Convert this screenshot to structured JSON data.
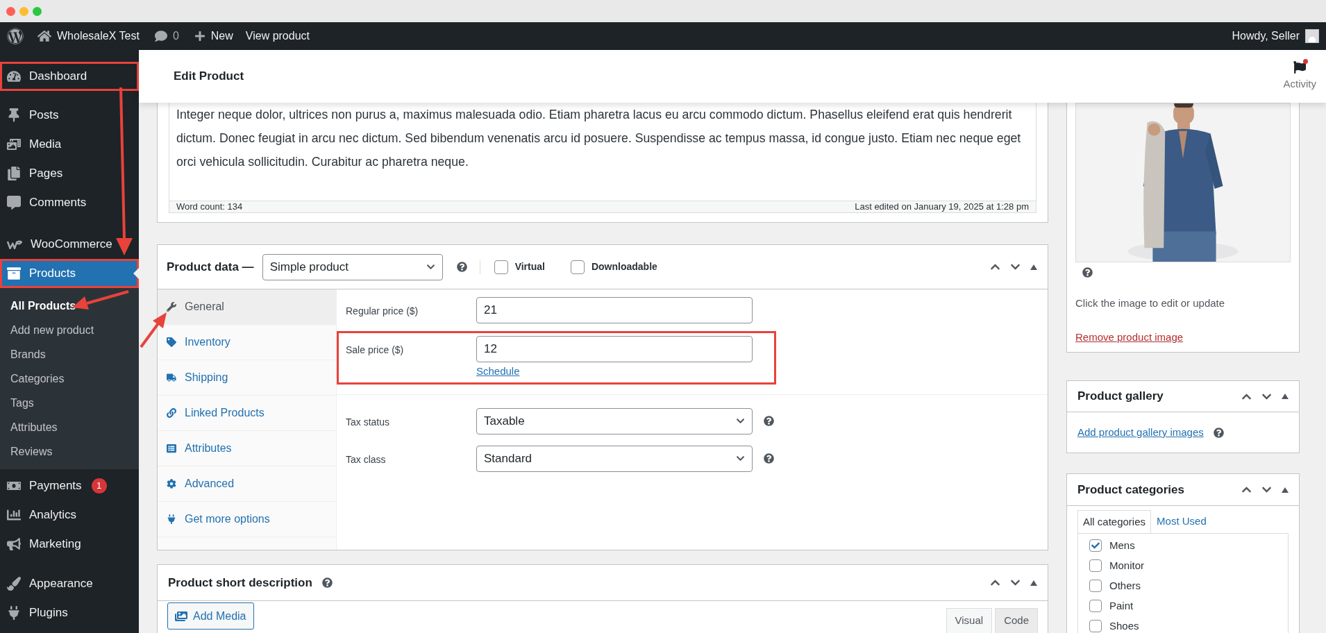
{
  "window_controls": [
    {
      "color": "#ff5f57"
    },
    {
      "color": "#febc2e"
    },
    {
      "color": "#28c840"
    }
  ],
  "admin_bar": {
    "site_name": "WholesaleX Test",
    "comments_count": "0",
    "new_label": "New",
    "view_label": "View product",
    "greeting": "Howdy, Seller"
  },
  "sidebar": {
    "groups": [
      [
        {
          "label": "Dashboard",
          "selected": false,
          "highlighted": true
        }
      ],
      [
        {
          "label": "Posts",
          "selected": false,
          "highlighted": false
        },
        {
          "label": "Media",
          "selected": false,
          "highlighted": false
        },
        {
          "label": "Pages",
          "selected": false,
          "highlighted": false
        },
        {
          "label": "Comments",
          "selected": false,
          "highlighted": false
        }
      ],
      [
        {
          "label": "WooCommerce",
          "selected": false,
          "highlighted": false
        },
        {
          "label": "Products",
          "selected": true,
          "highlighted": true,
          "children": [
            {
              "label": "All Products",
              "selected": true
            },
            {
              "label": "Add new product",
              "selected": false
            },
            {
              "label": "Brands",
              "selected": false
            },
            {
              "label": "Categories",
              "selected": false
            },
            {
              "label": "Tags",
              "selected": false
            },
            {
              "label": "Attributes",
              "selected": false
            },
            {
              "label": "Reviews",
              "selected": false
            }
          ]
        }
      ],
      [
        {
          "label": "Payments",
          "selected": false,
          "highlighted": false,
          "badge": "1"
        },
        {
          "label": "Analytics",
          "selected": false,
          "highlighted": false
        },
        {
          "label": "Marketing",
          "selected": false,
          "highlighted": false
        }
      ],
      [
        {
          "label": "Appearance",
          "selected": false,
          "highlighted": false
        },
        {
          "label": "Plugins",
          "selected": false,
          "highlighted": false
        }
      ]
    ]
  },
  "page_header": {
    "title": "Edit Product",
    "activity_label": "Activity",
    "has_notification": true
  },
  "editor": {
    "text": "Integer neque dolor, ultrices non purus a, maximus malesuada odio. Etiam pharetra lacus eu arcu commodo dictum. Phasellus eleifend erat quis hendrerit dictum. Donec feugiat in arcu nec dictum. Sed bibendum venenatis arcu id posuere. Suspendisse ac tempus massa, id congue justo. Etiam nec neque eget orci vehicula sollicitudin. Curabitur ac pharetra neque.",
    "word_count": "Word count: 134",
    "last_edited": "Last edited on January 19, 2025 at 1:28 pm"
  },
  "product_data": {
    "title": "Product data —",
    "product_type": "Simple product",
    "options": [
      {
        "label": "Virtual",
        "checked": false
      },
      {
        "label": "Downloadable",
        "checked": false
      }
    ],
    "tabs": [
      {
        "label": "General",
        "selected": true
      },
      {
        "label": "Inventory",
        "selected": false
      },
      {
        "label": "Shipping",
        "selected": false
      },
      {
        "label": "Linked Products",
        "selected": false
      },
      {
        "label": "Attributes",
        "selected": false
      },
      {
        "label": "Advanced",
        "selected": false
      },
      {
        "label": "Get more options",
        "selected": false
      }
    ],
    "field_groups": [
      [
        {
          "kind": "input",
          "label": "Regular price ($)",
          "value": "21",
          "highlighted": false
        },
        {
          "kind": "input",
          "label": "Sale price ($)",
          "value": "12",
          "link": "Schedule",
          "highlighted": true
        }
      ],
      [
        {
          "kind": "select",
          "label": "Tax status",
          "value": "Taxable",
          "highlighted": false
        },
        {
          "kind": "select",
          "label": "Tax class",
          "value": "Standard",
          "highlighted": false
        }
      ]
    ]
  },
  "short_description": {
    "title": "Product short description",
    "add_media": "Add Media",
    "editor_tabs": [
      {
        "label": "Visual",
        "selected": true
      },
      {
        "label": "Code",
        "selected": false
      }
    ]
  },
  "product_image": {
    "hint": "Click the image to edit or update",
    "remove_link": "Remove product image"
  },
  "product_gallery": {
    "title": "Product gallery",
    "add_link": "Add product gallery images"
  },
  "product_categories": {
    "title": "Product categories",
    "tabs": [
      {
        "label": "All categories",
        "selected": true
      },
      {
        "label": "Most Used",
        "selected": false
      }
    ],
    "items": [
      {
        "label": "Mens",
        "checked": true
      },
      {
        "label": "Monitor",
        "checked": false
      },
      {
        "label": "Others",
        "checked": false
      },
      {
        "label": "Paint",
        "checked": false
      },
      {
        "label": "Shoes",
        "checked": false
      }
    ]
  }
}
